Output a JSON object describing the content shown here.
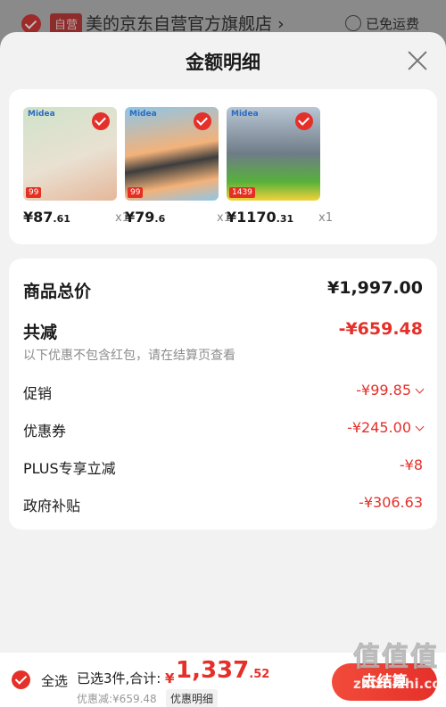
{
  "store": {
    "tag": "自营",
    "name": "美的京东自营官方旗舰店 ›",
    "free_shipping": "已免运费"
  },
  "sheet": {
    "title": "金额明细"
  },
  "products": [
    {
      "brand": "Midea",
      "badge": "99",
      "price_main": "¥87",
      "price_dec": ".61",
      "qty": "x1",
      "colors": [
        "#cfe2c9",
        "#e5b79a"
      ]
    },
    {
      "brand": "Midea",
      "badge": "99",
      "price_main": "¥79",
      "price_dec": ".6",
      "qty": "x1",
      "colors": [
        "#f3b27a",
        "#8ec6e8"
      ]
    },
    {
      "brand": "Midea",
      "badge": "1439",
      "price_main": "¥1170",
      "price_dec": ".31",
      "qty": "x1",
      "colors": [
        "#b9c6d4",
        "#57b13a"
      ]
    }
  ],
  "summary": {
    "total_label": "商品总价",
    "total_value": "¥1,997.00",
    "reduce_label": "共减",
    "reduce_value": "-¥659.48",
    "note": "以下优惠不包含红包，请在结算页查看",
    "items": [
      {
        "label": "促销",
        "value": "-¥99.85"
      },
      {
        "label": "优惠券",
        "value": "-¥245.00"
      },
      {
        "label": "PLUS专享立减",
        "value": "-¥8"
      },
      {
        "label": "政府补贴",
        "value": "-¥306.63"
      }
    ]
  },
  "bottom": {
    "select_all": "全选",
    "selected_text": "已选3件,合计:",
    "currency": "¥",
    "amount_main": "1,337",
    "amount_dec": ".52",
    "discount_text": "优惠减:¥659.48",
    "detail_link": "优惠明细",
    "checkout": "去结算"
  },
  "watermark": {
    "logo": "值值值",
    "url": "zhizhizhi.com"
  },
  "colors": {
    "accent": "#e5302a",
    "text": "#1a1a1a",
    "muted": "#8c8c8c",
    "background": "#f2f2f2"
  }
}
